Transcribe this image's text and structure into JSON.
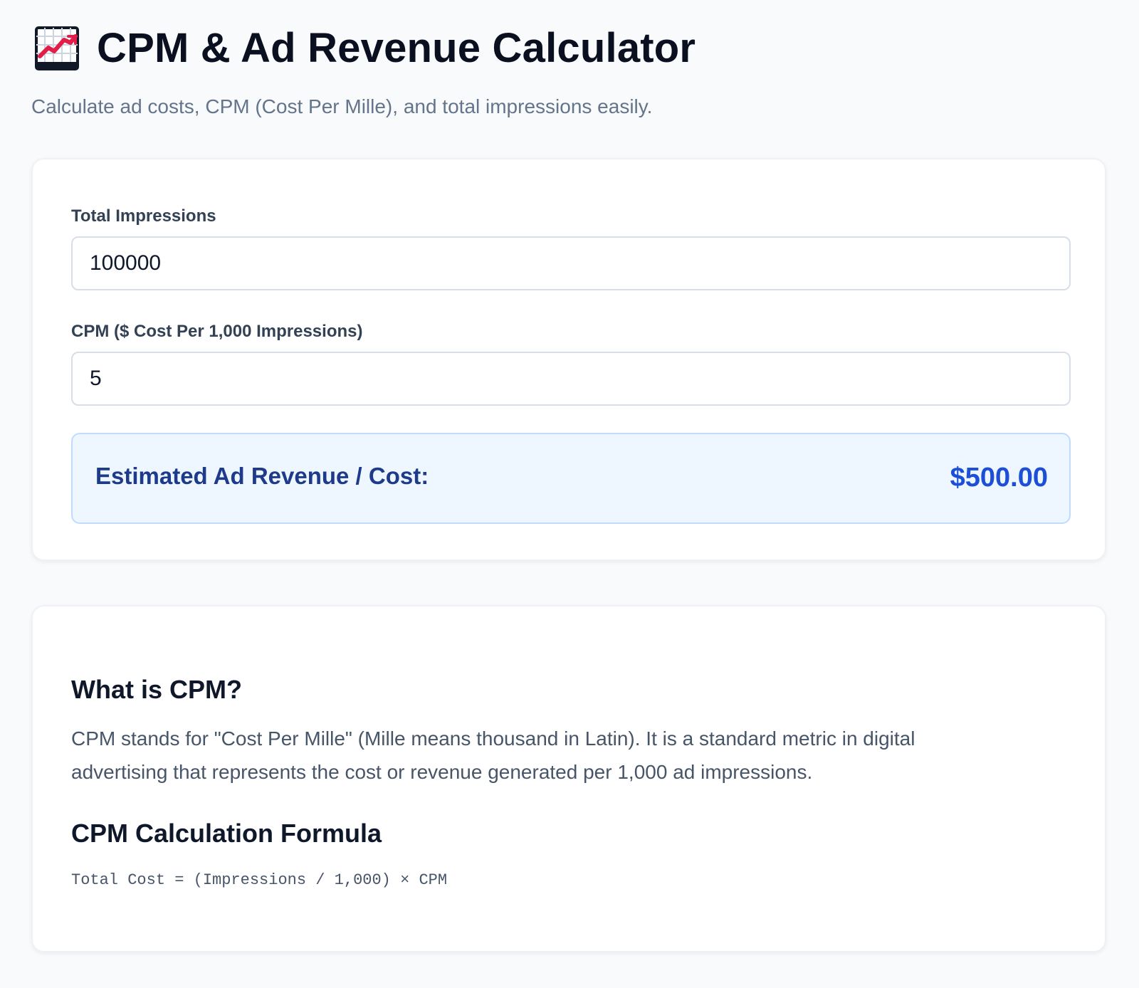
{
  "header": {
    "icon": "chart-increasing-icon",
    "title": "CPM & Ad Revenue Calculator",
    "subtitle": "Calculate ad costs, CPM (Cost Per Mille), and total impressions easily."
  },
  "calculator": {
    "impressions": {
      "label": "Total Impressions",
      "value": "100000"
    },
    "cpm": {
      "label": "CPM ($ Cost Per 1,000 Impressions)",
      "value": "5"
    },
    "result": {
      "label": "Estimated Ad Revenue / Cost:",
      "value": "$500.00"
    }
  },
  "info": {
    "what_heading": "What is CPM?",
    "what_text": "CPM stands for \"Cost Per Mille\" (Mille means thousand in Latin). It is a standard metric in digital advertising that represents the cost or revenue generated per 1,000 ad impressions.",
    "formula_heading": "CPM Calculation Formula",
    "formula": "Total Cost = (Impressions / 1,000) × CPM"
  },
  "colors": {
    "background": "#f8fafc",
    "accent": "#1d4ed8",
    "result_background": "#eef6ff",
    "muted_text": "#64748b"
  }
}
